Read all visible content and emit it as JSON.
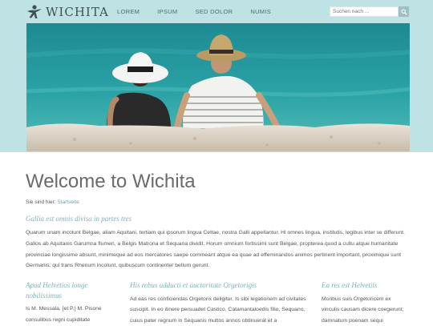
{
  "header": {
    "logo_text": "WICHITA",
    "logo_icon": "running-figure-icon",
    "nav": [
      "LOREM",
      "IPSUM",
      "SED DOLOR",
      "NUMIS"
    ],
    "search_placeholder": "Suchen nach ...",
    "search_icon": "search-icon"
  },
  "hero": {
    "image": "couple-with-hats-sitting-at-beach-photo"
  },
  "main": {
    "title": "Welcome to Wichita",
    "breadcrumb_label": "Sie sind hier:",
    "breadcrumb_link": "Startseite",
    "lead_heading": "Gallia est omnis divisa in partes tres",
    "lead_text": "Quarum unam incolunt Belgae, aliam Aquitani, tertiam qui ipsorum lingua Celtae, nostra Galli appellantur. Hi omnes lingua, institutis, legibus inter se differunt. Gallos ab Aquitanis Garumna flumen, a Belgis Matrona et Sequana dividit. Horum omnium fortissimi sunt Belgae, propterea quod a cultu atque humanitate provinciae longissime absunt, minimeque ad eos mercatores saepe commeant atque ea quae ad effeminandos animos pertinent important, proximique sunt Germanis, qui trans Rhenum incolunt, quibuscum continenter bellum gerunt.",
    "columns": [
      {
        "heading": "Apud Helvetios longe nobilissimus",
        "text": "Is M. Messala, [et P.] M. Pisone consulibus regni cupiditate"
      },
      {
        "heading": "His rebus adducti et auctoritate Orgetorigis",
        "text": "Ad eas res conficiendas Orgetorix deligitur. Is sibi legationem ad civitates suscipit. In eo itinere persuadet Castico, Catamantaloedis filio, Sequano, cuius pater regnum in Sequanis multos annos obtinuerat et a"
      },
      {
        "heading": "Ea res est Helvetiis",
        "text": "Moribus suis Orgetoricem ex vinculis causam dicere coegerunt; damnatum poenam sequi"
      }
    ]
  },
  "colors": {
    "header_bg": "#bfe2e5",
    "accent": "#7eb3b9",
    "link": "#6fa4ab"
  }
}
